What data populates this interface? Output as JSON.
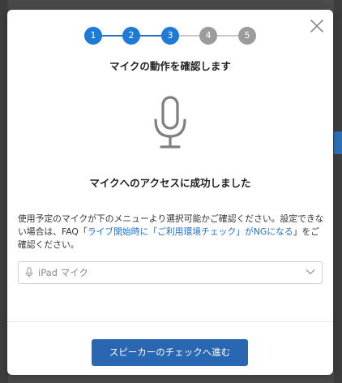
{
  "stepper": {
    "steps": [
      "1",
      "2",
      "3",
      "4",
      "5"
    ],
    "active_count": 3
  },
  "modal": {
    "title": "マイクの動作を確認します",
    "success_message": "マイクへのアクセスに成功しました",
    "description_prefix": "使用予定のマイクが下のメニューより選択可能かご確認ください。設定できない場合は、FAQ「",
    "faq_link": "ライブ開始時に「ご利用環境チェック」がNGになる",
    "description_suffix": "」をご確認ください。",
    "mic_select": {
      "selected": "iPad マイク"
    },
    "next_button": "スピーカーのチェックへ進む"
  },
  "colors": {
    "accent": "#1f7ad6",
    "button": "#2a67b3",
    "link": "#1f6fc7",
    "inactive_step": "#9b9b9b"
  },
  "icons": {
    "close": "close-icon",
    "microphone": "microphone-icon",
    "chevron": "chevron-down-icon"
  }
}
